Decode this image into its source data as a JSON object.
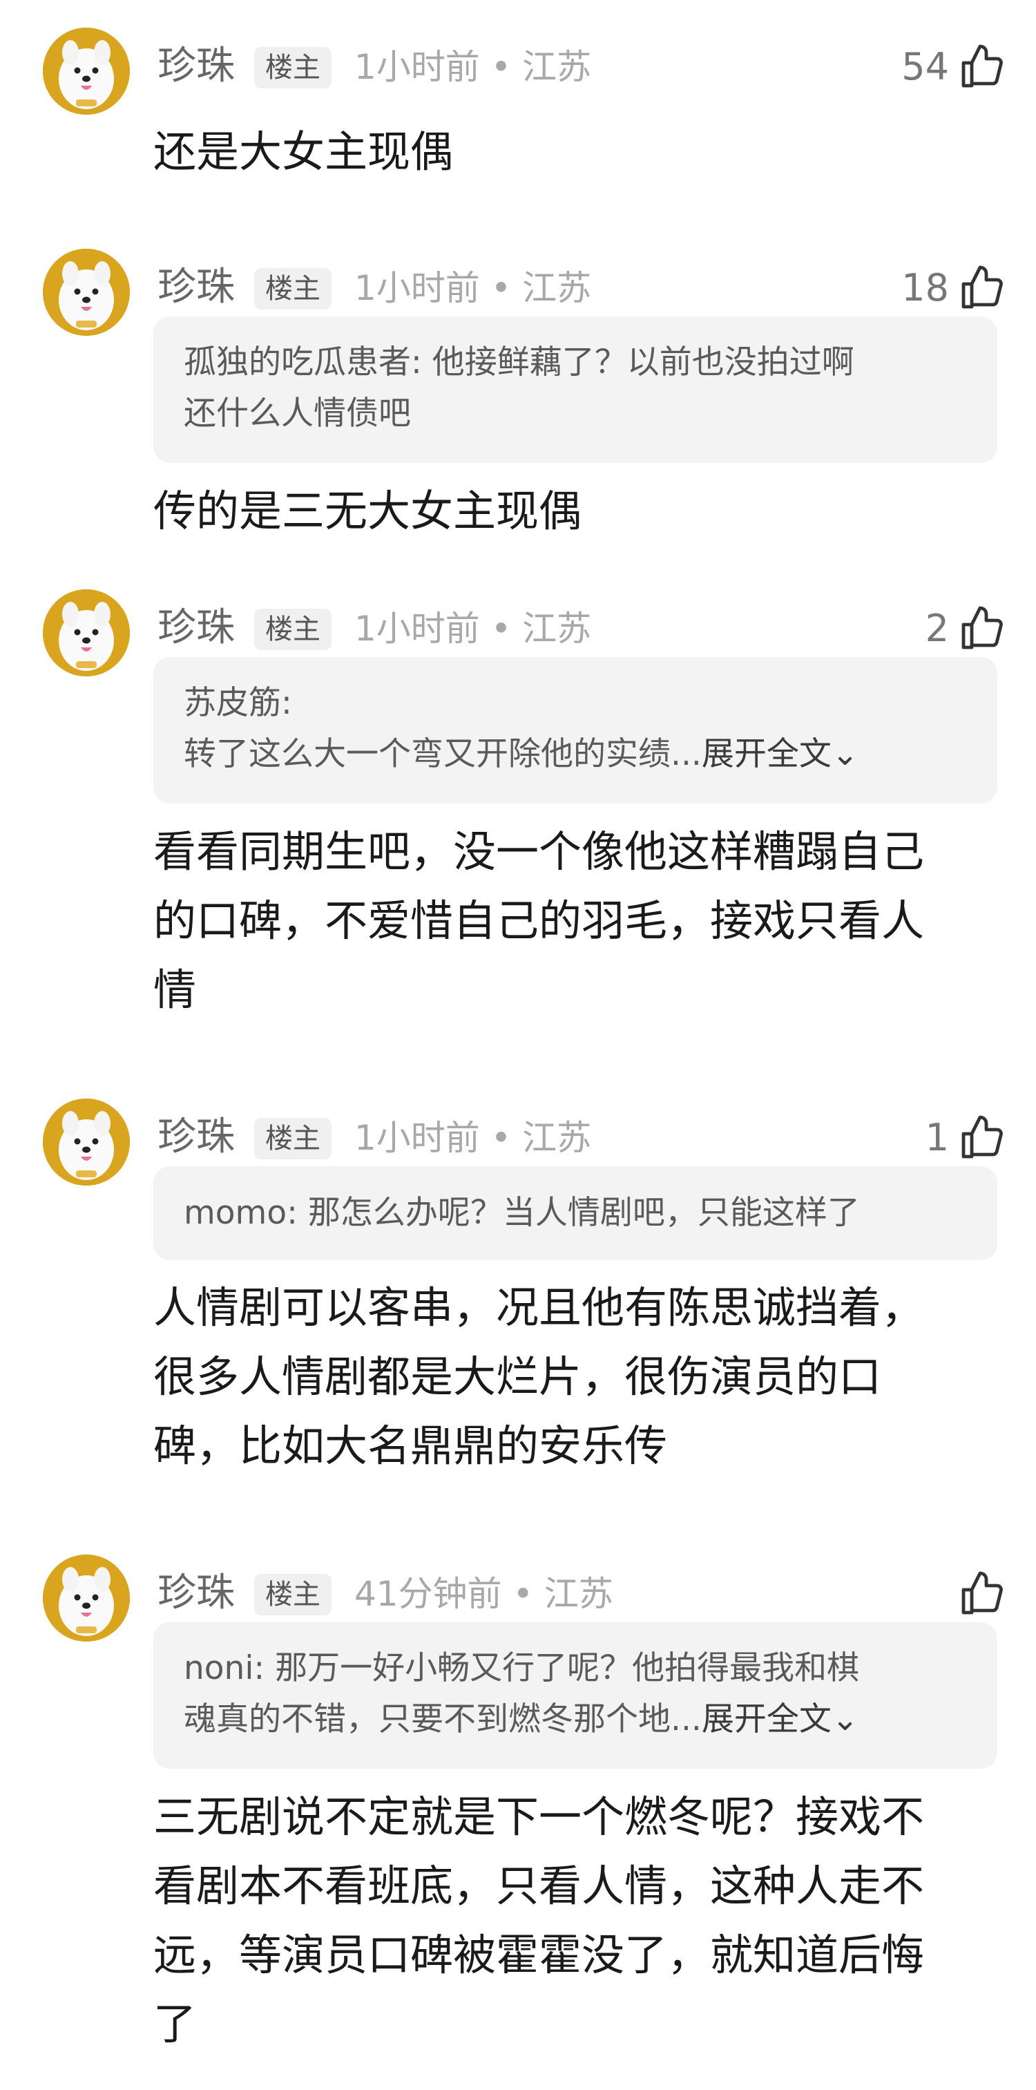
{
  "comments": [
    {
      "author": "珍珠",
      "badge": "楼主",
      "meta": "1小时前 • 江苏",
      "likes": "54",
      "quote": null,
      "text_lines": [
        "还是大女主现偶"
      ]
    },
    {
      "author": "珍珠",
      "badge": "楼主",
      "meta": "1小时前 • 江苏",
      "likes": "18",
      "quote": {
        "lines": [
          "孤独的吃瓜患者: 他接鲜藕了？以前也没拍过啊",
          "还什么人情债吧"
        ],
        "expand": ""
      },
      "text_lines": [
        "传的是三无大女主现偶"
      ]
    },
    {
      "author": "珍珠",
      "badge": "楼主",
      "meta": "1小时前 • 江苏",
      "likes": "2",
      "quote": {
        "lines": [
          "苏皮筋:",
          "转了这么大一个弯又开除他的实绩..."
        ],
        "expand": "展开全文⌄"
      },
      "text_lines": [
        "看看同期生吧，没一个像他这样糟蹋自己",
        "的口碑，不爱惜自己的羽毛，接戏只看人",
        "情"
      ]
    },
    {
      "author": "珍珠",
      "badge": "楼主",
      "meta": "1小时前 • 江苏",
      "likes": "1",
      "quote": {
        "lines": [
          "momo: 那怎么办呢？当人情剧吧，只能这样了"
        ],
        "expand": ""
      },
      "text_lines": [
        "人情剧可以客串，况且他有陈思诚挡着，",
        "很多人情剧都是大烂片，很伤演员的口",
        "碑，比如大名鼎鼎的安乐传"
      ]
    },
    {
      "author": "珍珠",
      "badge": "楼主",
      "meta": "41分钟前 • 江苏",
      "likes": "",
      "quote": {
        "lines": [
          "noni: 那万一好小畅又行了呢？他拍得最我和棋",
          "魂真的不错，只要不到燃冬那个地..."
        ],
        "expand": "展开全文⌄"
      },
      "text_lines": [
        "三无剧说不定就是下一个燃冬呢？接戏不",
        "看剧本不看班底，只看人情，这种人走不",
        "远，等演员口碑被霍霍没了，就知道后悔",
        "了"
      ]
    }
  ],
  "icons": {
    "like": "thumbs-up-icon",
    "avatar": "samoyed-dog-avatar"
  },
  "colors": {
    "quote_bg": "#f3f3f3",
    "badge_bg": "#f0f0f0",
    "avatar_bg": "#d9a41e"
  }
}
